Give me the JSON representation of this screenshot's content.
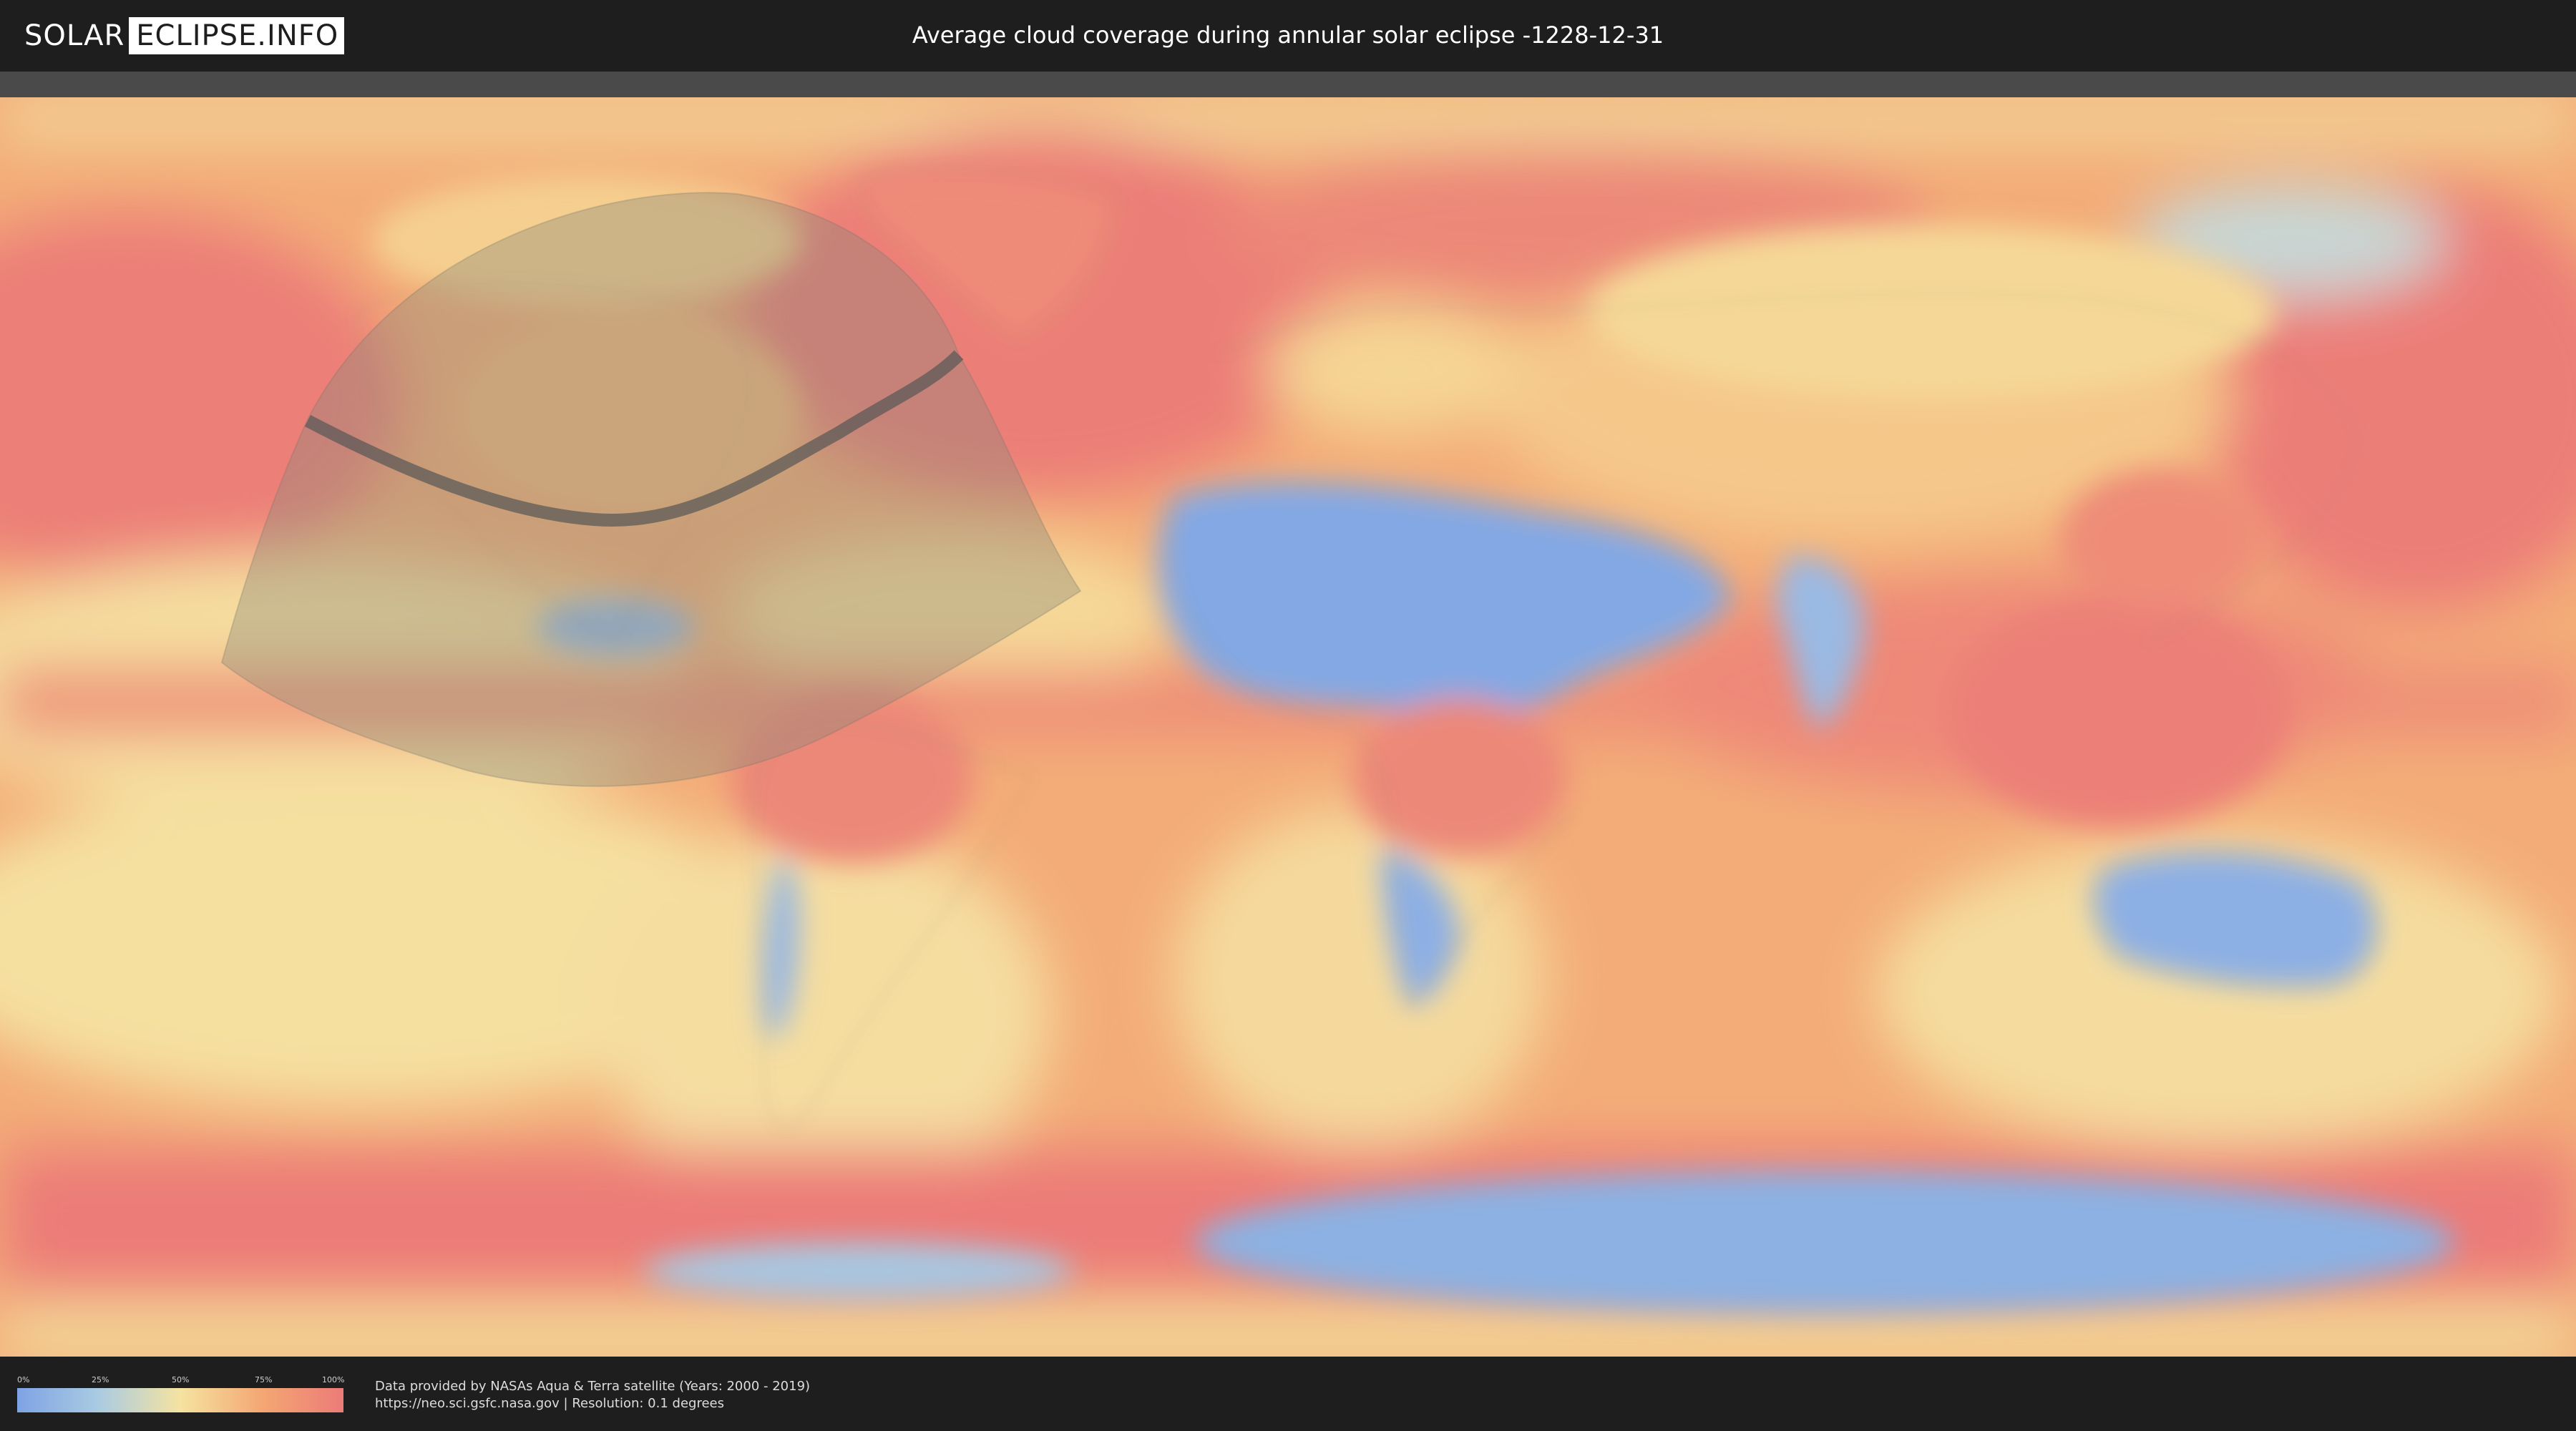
{
  "header": {
    "logo_left": "SOLAR",
    "logo_right": "ECLIPSE.INFO",
    "title": "Average cloud coverage during annular solar eclipse -1228-12-31"
  },
  "map": {
    "type": "world-cloud-coverage",
    "colors": {
      "clear": "#7ea3e4",
      "low": "#aacbe2",
      "mid": "#f5e3a1",
      "high": "#f4a773",
      "overcast": "#ec7b78"
    },
    "eclipse_overlay": {
      "visibility_zone_color": "#8a8a7a",
      "path_color": "#555555"
    }
  },
  "legend": {
    "ticks": [
      "0%",
      "25%",
      "50%",
      "75%",
      "100%"
    ]
  },
  "credits": {
    "line1": "Data provided by NASAs Aqua & Terra satellite (Years: 2000 - 2019)",
    "line2": "https://neo.sci.gsfc.nasa.gov | Resolution: 0.1 degrees"
  }
}
